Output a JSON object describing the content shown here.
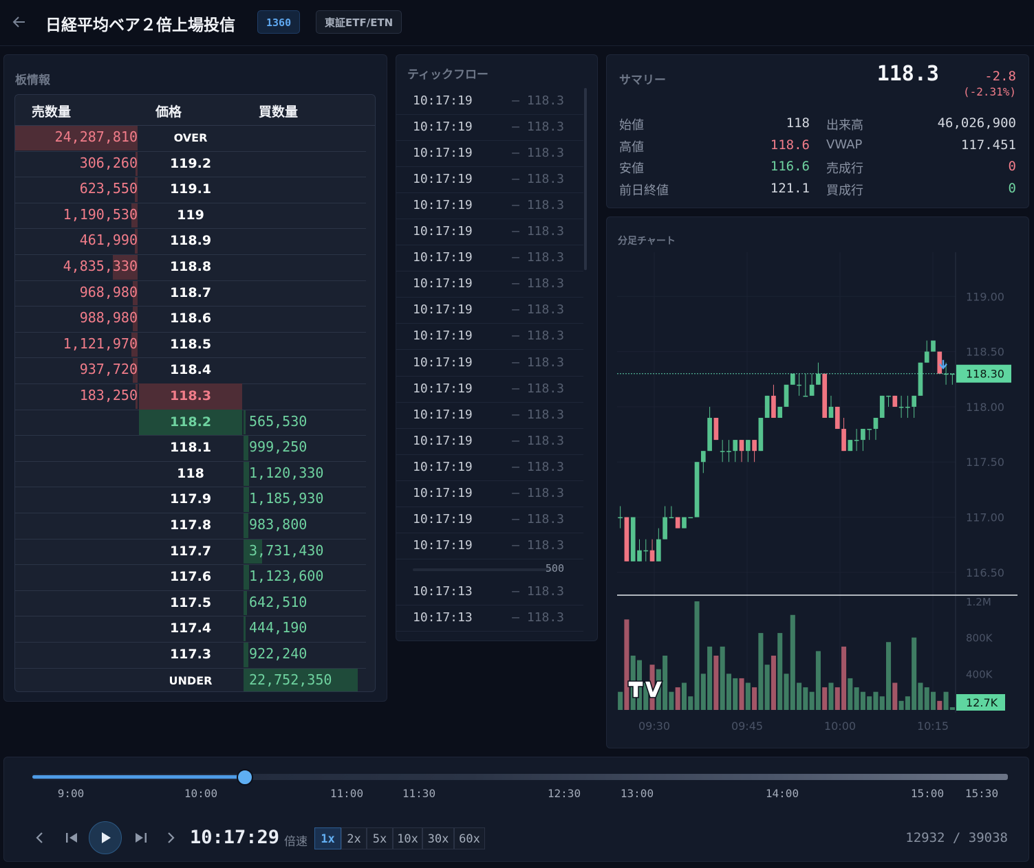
{
  "header": {
    "back_icon": "arrow-left-icon",
    "title": "日経平均ベア２倍上場投信",
    "code": "1360",
    "market": "東証ETF/ETN"
  },
  "orderbook": {
    "title": "板情報",
    "col_sell": "売数量",
    "col_price": "価格",
    "col_buy": "買数量",
    "rows": [
      {
        "sell": "24,287,810",
        "price": "OVER",
        "buy": "",
        "sell_level": 1.0,
        "buy_level": 0
      },
      {
        "sell": "306,260",
        "price": "119.2",
        "buy": "",
        "sell_level": 0.01,
        "buy_level": 0
      },
      {
        "sell": "623,550",
        "price": "119.1",
        "buy": "",
        "sell_level": 0.02,
        "buy_level": 0
      },
      {
        "sell": "1,190,530",
        "price": "119",
        "buy": "",
        "sell_level": 0.05,
        "buy_level": 0
      },
      {
        "sell": "461,990",
        "price": "118.9",
        "buy": "",
        "sell_level": 0.02,
        "buy_level": 0
      },
      {
        "sell": "4,835,330",
        "price": "118.8",
        "buy": "",
        "sell_level": 0.2,
        "buy_level": 0
      },
      {
        "sell": "968,980",
        "price": "118.7",
        "buy": "",
        "sell_level": 0.04,
        "buy_level": 0
      },
      {
        "sell": "988,980",
        "price": "118.6",
        "buy": "",
        "sell_level": 0.04,
        "buy_level": 0
      },
      {
        "sell": "1,121,970",
        "price": "118.5",
        "buy": "",
        "sell_level": 0.05,
        "buy_level": 0
      },
      {
        "sell": "937,720",
        "price": "118.4",
        "buy": "",
        "sell_level": 0.04,
        "buy_level": 0
      },
      {
        "sell": "183,250",
        "price": "118.3",
        "buy": "",
        "sell_level": 0.01,
        "buy_level": 0,
        "best": "ask"
      },
      {
        "sell": "",
        "price": "118.2",
        "buy": "565,530",
        "sell_level": 0,
        "buy_level": 0.02,
        "best": "bid"
      },
      {
        "sell": "",
        "price": "118.1",
        "buy": "999,250",
        "sell_level": 0,
        "buy_level": 0.04
      },
      {
        "sell": "",
        "price": "118",
        "buy": "1,120,330",
        "sell_level": 0,
        "buy_level": 0.05
      },
      {
        "sell": "",
        "price": "117.9",
        "buy": "1,185,930",
        "sell_level": 0,
        "buy_level": 0.05
      },
      {
        "sell": "",
        "price": "117.8",
        "buy": "983,800",
        "sell_level": 0,
        "buy_level": 0.04
      },
      {
        "sell": "",
        "price": "117.7",
        "buy": "3,731,430",
        "sell_level": 0,
        "buy_level": 0.16
      },
      {
        "sell": "",
        "price": "117.6",
        "buy": "1,123,600",
        "sell_level": 0,
        "buy_level": 0.05
      },
      {
        "sell": "",
        "price": "117.5",
        "buy": "642,510",
        "sell_level": 0,
        "buy_level": 0.03
      },
      {
        "sell": "",
        "price": "117.4",
        "buy": "444,190",
        "sell_level": 0,
        "buy_level": 0.02
      },
      {
        "sell": "",
        "price": "117.3",
        "buy": "922,240",
        "sell_level": 0,
        "buy_level": 0.04
      },
      {
        "sell": "",
        "price": "UNDER",
        "buy": "22,752,350",
        "sell_level": 0,
        "buy_level": 1.0
      }
    ]
  },
  "tickflow": {
    "title": "ティックフロー",
    "ticks_a": [
      {
        "time": "10:17:19",
        "price": "— 118.3"
      },
      {
        "time": "10:17:19",
        "price": "— 118.3"
      },
      {
        "time": "10:17:19",
        "price": "— 118.3"
      },
      {
        "time": "10:17:19",
        "price": "— 118.3"
      },
      {
        "time": "10:17:19",
        "price": "— 118.3"
      },
      {
        "time": "10:17:19",
        "price": "— 118.3"
      },
      {
        "time": "10:17:19",
        "price": "— 118.3"
      },
      {
        "time": "10:17:19",
        "price": "— 118.3"
      },
      {
        "time": "10:17:19",
        "price": "— 118.3"
      },
      {
        "time": "10:17:19",
        "price": "— 118.3"
      },
      {
        "time": "10:17:19",
        "price": "— 118.3"
      },
      {
        "time": "10:17:19",
        "price": "— 118.3"
      },
      {
        "time": "10:17:19",
        "price": "— 118.3"
      },
      {
        "time": "10:17:19",
        "price": "— 118.3"
      },
      {
        "time": "10:17:19",
        "price": "— 118.3"
      },
      {
        "time": "10:17:19",
        "price": "— 118.3"
      },
      {
        "time": "10:17:19",
        "price": "— 118.3"
      },
      {
        "time": "10:17:19",
        "price": "— 118.3"
      }
    ],
    "group_volume": "500",
    "ticks_b": [
      {
        "time": "10:17:13",
        "price": "— 118.3"
      },
      {
        "time": "10:17:13",
        "price": "— 118.3"
      }
    ]
  },
  "summary": {
    "title": "サマリー",
    "price": "118.3",
    "change": "-2.8",
    "change_pct": "(-2.31%)",
    "left": [
      {
        "label": "始値",
        "value": "118",
        "color": "#d4d8e0"
      },
      {
        "label": "高値",
        "value": "118.6",
        "color": "#f27d8a"
      },
      {
        "label": "安値",
        "value": "116.6",
        "color": "#6fd3a0"
      },
      {
        "label": "前日終値",
        "value": "121.1",
        "color": "#d4d8e0"
      }
    ],
    "right": [
      {
        "label": "出来高",
        "value": "46,026,900",
        "color": "#d4d8e0"
      },
      {
        "label": "VWAP",
        "value": "117.451",
        "color": "#d4d8e0"
      },
      {
        "label": "売成行",
        "value": "0",
        "color": "#f27d8a"
      },
      {
        "label": "買成行",
        "value": "0",
        "color": "#6fd3a0"
      }
    ]
  },
  "chart": {
    "title": "分足チャート",
    "last_price_label": "118.30",
    "last_volume_label": "12.7K",
    "marker_icon": "arrow-down-icon",
    "watermark_icon": "tradingview-logo-icon"
  },
  "chart_data": {
    "type": "candlestick",
    "y_ticks": [
      "119.00",
      "118.50",
      "118.00",
      "117.50",
      "117.00",
      "116.50"
    ],
    "ylim": [
      116.3,
      119.4
    ],
    "vol_ticks": [
      "1.2M",
      "800K",
      "400K"
    ],
    "vol_max": 1200000,
    "x_ticks": [
      "09:30",
      "09:45",
      "10:00",
      "10:15"
    ],
    "last_price": 118.3,
    "last_volume": 12700,
    "candles": [
      [
        117.0,
        117.1,
        116.9,
        117.0,
        200000
      ],
      [
        117.0,
        117.0,
        116.6,
        116.6,
        1000000
      ],
      [
        116.6,
        117.0,
        116.6,
        117.0,
        600000
      ],
      [
        116.6,
        116.8,
        116.6,
        116.7,
        550000
      ],
      [
        116.7,
        116.8,
        116.6,
        116.7,
        300000
      ],
      [
        116.7,
        116.8,
        116.6,
        116.6,
        500000
      ],
      [
        116.6,
        116.9,
        116.6,
        116.8,
        450000
      ],
      [
        116.8,
        117.1,
        116.8,
        117.0,
        600000
      ],
      [
        117.0,
        117.1,
        117.0,
        117.0,
        200000
      ],
      [
        117.0,
        117.0,
        116.9,
        116.9,
        250000
      ],
      [
        116.9,
        117.0,
        116.9,
        117.0,
        300000
      ],
      [
        117.0,
        117.0,
        117.0,
        117.0,
        150000
      ],
      [
        117.0,
        117.5,
        117.0,
        117.5,
        1200000
      ],
      [
        117.5,
        117.6,
        117.4,
        117.6,
        400000
      ],
      [
        117.6,
        118.0,
        117.6,
        117.9,
        700000
      ],
      [
        117.9,
        117.9,
        117.7,
        117.7,
        600000
      ],
      [
        117.6,
        117.7,
        117.5,
        117.6,
        700000
      ],
      [
        117.6,
        117.7,
        117.5,
        117.6,
        400000
      ],
      [
        117.6,
        117.7,
        117.5,
        117.7,
        350000
      ],
      [
        117.7,
        117.7,
        117.5,
        117.6,
        350000
      ],
      [
        117.6,
        117.7,
        117.5,
        117.7,
        300000
      ],
      [
        117.7,
        117.7,
        117.5,
        117.6,
        250000
      ],
      [
        117.6,
        117.9,
        117.6,
        117.9,
        850000
      ],
      [
        117.9,
        118.1,
        117.9,
        118.1,
        500000
      ],
      [
        118.1,
        118.2,
        117.9,
        117.9,
        600000
      ],
      [
        117.9,
        118.0,
        117.9,
        118.0,
        850000
      ],
      [
        118.0,
        118.1,
        118.0,
        118.2,
        400000
      ],
      [
        118.2,
        118.3,
        118.2,
        118.3,
        1050000
      ],
      [
        118.2,
        118.3,
        118.1,
        118.2,
        300000
      ],
      [
        118.1,
        118.3,
        118.1,
        118.1,
        250000
      ],
      [
        118.1,
        118.3,
        118.1,
        118.2,
        200000
      ],
      [
        118.2,
        118.4,
        118.2,
        118.3,
        650000
      ],
      [
        118.3,
        118.3,
        117.9,
        117.9,
        250000
      ],
      [
        117.9,
        118.1,
        117.9,
        118.0,
        300000
      ],
      [
        118.0,
        118.0,
        117.8,
        117.8,
        250000
      ],
      [
        117.8,
        117.9,
        117.6,
        117.6,
        700000
      ],
      [
        117.6,
        117.7,
        117.6,
        117.7,
        350000
      ],
      [
        117.7,
        117.8,
        117.6,
        117.7,
        250000
      ],
      [
        117.7,
        117.8,
        117.6,
        117.8,
        200000
      ],
      [
        117.8,
        117.8,
        117.7,
        117.8,
        150000
      ],
      [
        117.8,
        117.9,
        117.7,
        117.9,
        200000
      ],
      [
        117.9,
        118.1,
        117.9,
        118.1,
        150000
      ],
      [
        118.1,
        118.1,
        118.0,
        118.1,
        750000
      ],
      [
        118.1,
        118.1,
        118.0,
        118.0,
        300000
      ],
      [
        118.0,
        118.1,
        117.9,
        118.0,
        100000
      ],
      [
        118.0,
        118.1,
        117.9,
        118.0,
        150000
      ],
      [
        118.0,
        118.1,
        117.9,
        118.1,
        800000
      ],
      [
        118.1,
        118.4,
        118.1,
        118.4,
        300000
      ],
      [
        118.4,
        118.6,
        118.4,
        118.5,
        250000
      ],
      [
        118.5,
        118.6,
        118.5,
        118.6,
        200000
      ],
      [
        118.5,
        118.5,
        118.3,
        118.3,
        100000
      ],
      [
        118.3,
        118.4,
        118.2,
        118.3,
        200000
      ],
      [
        118.3,
        118.3,
        118.2,
        118.3,
        30000
      ]
    ]
  },
  "player": {
    "timeline_labels": [
      "9:00",
      "10:00",
      "11:00",
      "11:30",
      "12:30",
      "13:00",
      "14:00",
      "15:00",
      "15:30"
    ],
    "progress": 0.218,
    "time": "10:17:29",
    "speed_label": "倍速",
    "speeds": [
      "1x",
      "2x",
      "5x",
      "10x",
      "30x",
      "60x"
    ],
    "active_speed": "1x",
    "counter": "12932 / 39038"
  }
}
